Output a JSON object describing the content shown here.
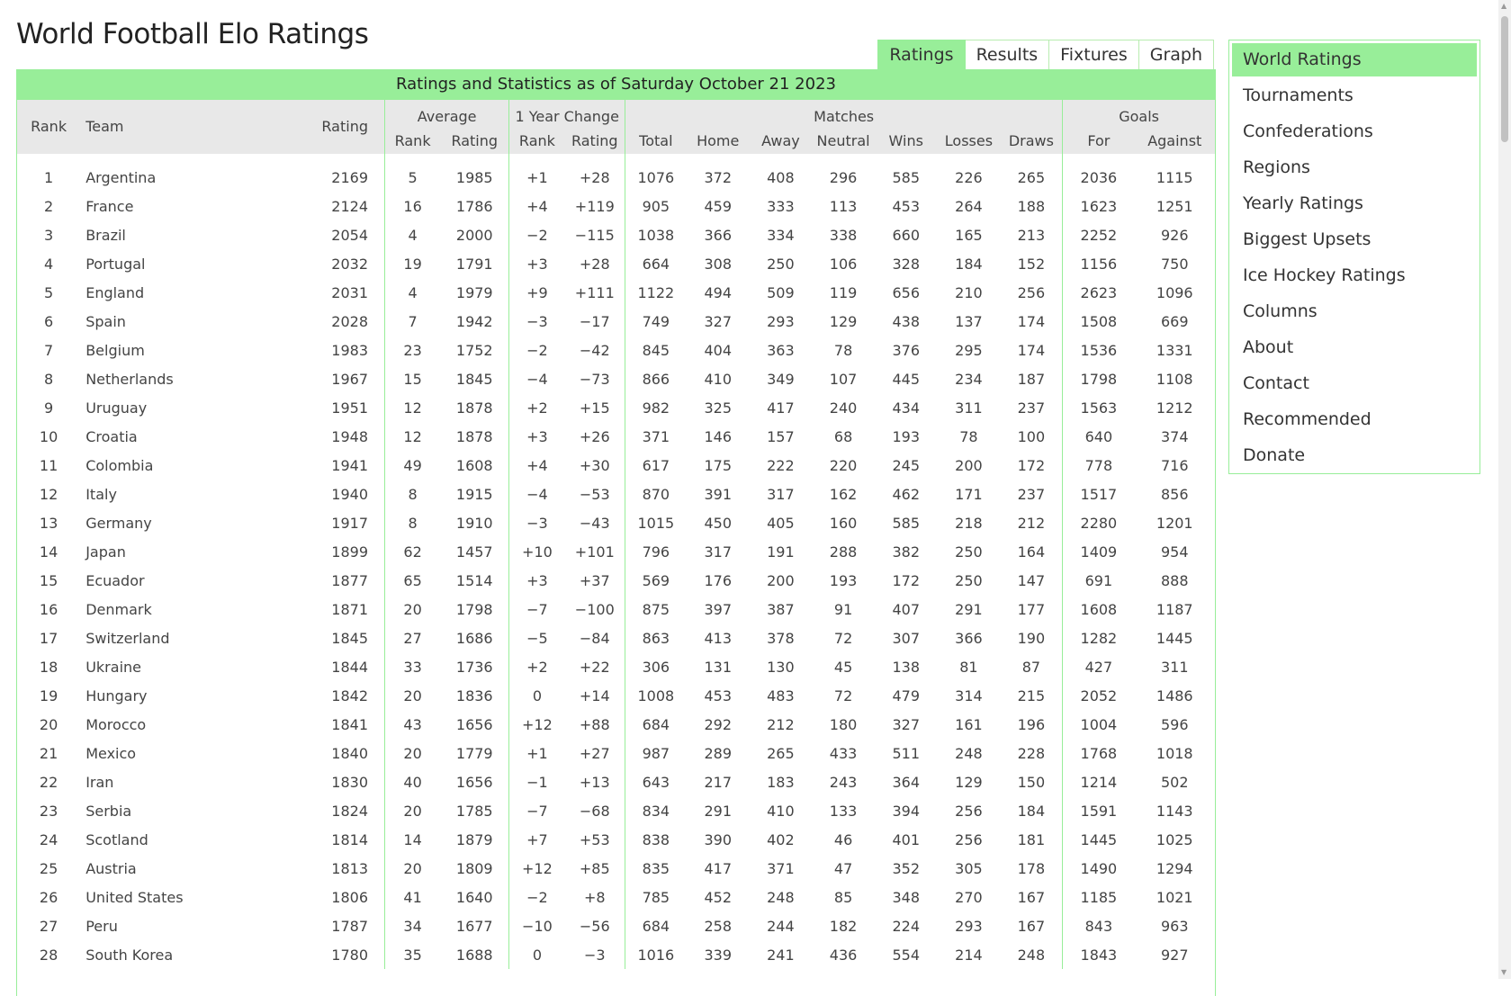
{
  "page": {
    "title": "World Football Elo Ratings"
  },
  "tabs": [
    {
      "label": "Ratings",
      "active": true
    },
    {
      "label": "Results"
    },
    {
      "label": "Fixtures"
    },
    {
      "label": "Graph"
    }
  ],
  "banner": "Ratings and Statistics as of Saturday October 21 2023",
  "headers": {
    "rank": "Rank",
    "team": "Team",
    "rating": "Rating",
    "average": "Average",
    "avg_rank": "Rank",
    "avg_rating": "Rating",
    "change": "1 Year Change",
    "chg_rank": "Rank",
    "chg_rating": "Rating",
    "matches": "Matches",
    "total": "Total",
    "home": "Home",
    "away": "Away",
    "neutral": "Neutral",
    "wins": "Wins",
    "losses": "Losses",
    "draws": "Draws",
    "goals": "Goals",
    "for": "For",
    "against": "Against"
  },
  "rows": [
    [
      "1",
      "Argentina",
      "2169",
      "5",
      "1985",
      "+1",
      "+28",
      "1076",
      "372",
      "408",
      "296",
      "585",
      "226",
      "265",
      "2036",
      "1115"
    ],
    [
      "2",
      "France",
      "2124",
      "16",
      "1786",
      "+4",
      "+119",
      "905",
      "459",
      "333",
      "113",
      "453",
      "264",
      "188",
      "1623",
      "1251"
    ],
    [
      "3",
      "Brazil",
      "2054",
      "4",
      "2000",
      "−2",
      "−115",
      "1038",
      "366",
      "334",
      "338",
      "660",
      "165",
      "213",
      "2252",
      "926"
    ],
    [
      "4",
      "Portugal",
      "2032",
      "19",
      "1791",
      "+3",
      "+28",
      "664",
      "308",
      "250",
      "106",
      "328",
      "184",
      "152",
      "1156",
      "750"
    ],
    [
      "5",
      "England",
      "2031",
      "4",
      "1979",
      "+9",
      "+111",
      "1122",
      "494",
      "509",
      "119",
      "656",
      "210",
      "256",
      "2623",
      "1096"
    ],
    [
      "6",
      "Spain",
      "2028",
      "7",
      "1942",
      "−3",
      "−17",
      "749",
      "327",
      "293",
      "129",
      "438",
      "137",
      "174",
      "1508",
      "669"
    ],
    [
      "7",
      "Belgium",
      "1983",
      "23",
      "1752",
      "−2",
      "−42",
      "845",
      "404",
      "363",
      "78",
      "376",
      "295",
      "174",
      "1536",
      "1331"
    ],
    [
      "8",
      "Netherlands",
      "1967",
      "15",
      "1845",
      "−4",
      "−73",
      "866",
      "410",
      "349",
      "107",
      "445",
      "234",
      "187",
      "1798",
      "1108"
    ],
    [
      "9",
      "Uruguay",
      "1951",
      "12",
      "1878",
      "+2",
      "+15",
      "982",
      "325",
      "417",
      "240",
      "434",
      "311",
      "237",
      "1563",
      "1212"
    ],
    [
      "10",
      "Croatia",
      "1948",
      "12",
      "1878",
      "+3",
      "+26",
      "371",
      "146",
      "157",
      "68",
      "193",
      "78",
      "100",
      "640",
      "374"
    ],
    [
      "11",
      "Colombia",
      "1941",
      "49",
      "1608",
      "+4",
      "+30",
      "617",
      "175",
      "222",
      "220",
      "245",
      "200",
      "172",
      "778",
      "716"
    ],
    [
      "12",
      "Italy",
      "1940",
      "8",
      "1915",
      "−4",
      "−53",
      "870",
      "391",
      "317",
      "162",
      "462",
      "171",
      "237",
      "1517",
      "856"
    ],
    [
      "13",
      "Germany",
      "1917",
      "8",
      "1910",
      "−3",
      "−43",
      "1015",
      "450",
      "405",
      "160",
      "585",
      "218",
      "212",
      "2280",
      "1201"
    ],
    [
      "14",
      "Japan",
      "1899",
      "62",
      "1457",
      "+10",
      "+101",
      "796",
      "317",
      "191",
      "288",
      "382",
      "250",
      "164",
      "1409",
      "954"
    ],
    [
      "15",
      "Ecuador",
      "1877",
      "65",
      "1514",
      "+3",
      "+37",
      "569",
      "176",
      "200",
      "193",
      "172",
      "250",
      "147",
      "691",
      "888"
    ],
    [
      "16",
      "Denmark",
      "1871",
      "20",
      "1798",
      "−7",
      "−100",
      "875",
      "397",
      "387",
      "91",
      "407",
      "291",
      "177",
      "1608",
      "1187"
    ],
    [
      "17",
      "Switzerland",
      "1845",
      "27",
      "1686",
      "−5",
      "−84",
      "863",
      "413",
      "378",
      "72",
      "307",
      "366",
      "190",
      "1282",
      "1445"
    ],
    [
      "18",
      "Ukraine",
      "1844",
      "33",
      "1736",
      "+2",
      "+22",
      "306",
      "131",
      "130",
      "45",
      "138",
      "81",
      "87",
      "427",
      "311"
    ],
    [
      "19",
      "Hungary",
      "1842",
      "20",
      "1836",
      "0",
      "+14",
      "1008",
      "453",
      "483",
      "72",
      "479",
      "314",
      "215",
      "2052",
      "1486"
    ],
    [
      "20",
      "Morocco",
      "1841",
      "43",
      "1656",
      "+12",
      "+88",
      "684",
      "292",
      "212",
      "180",
      "327",
      "161",
      "196",
      "1004",
      "596"
    ],
    [
      "21",
      "Mexico",
      "1840",
      "20",
      "1779",
      "+1",
      "+27",
      "987",
      "289",
      "265",
      "433",
      "511",
      "248",
      "228",
      "1768",
      "1018"
    ],
    [
      "22",
      "Iran",
      "1830",
      "40",
      "1656",
      "−1",
      "+13",
      "643",
      "217",
      "183",
      "243",
      "364",
      "129",
      "150",
      "1214",
      "502"
    ],
    [
      "23",
      "Serbia",
      "1824",
      "20",
      "1785",
      "−7",
      "−68",
      "834",
      "291",
      "410",
      "133",
      "394",
      "256",
      "184",
      "1591",
      "1143"
    ],
    [
      "24",
      "Scotland",
      "1814",
      "14",
      "1879",
      "+7",
      "+53",
      "838",
      "390",
      "402",
      "46",
      "401",
      "256",
      "181",
      "1445",
      "1025"
    ],
    [
      "25",
      "Austria",
      "1813",
      "20",
      "1809",
      "+12",
      "+85",
      "835",
      "417",
      "371",
      "47",
      "352",
      "305",
      "178",
      "1490",
      "1294"
    ],
    [
      "26",
      "United States",
      "1806",
      "41",
      "1640",
      "−2",
      "+8",
      "785",
      "452",
      "248",
      "85",
      "348",
      "270",
      "167",
      "1185",
      "1021"
    ],
    [
      "27",
      "Peru",
      "1787",
      "34",
      "1677",
      "−10",
      "−56",
      "684",
      "258",
      "244",
      "182",
      "224",
      "293",
      "167",
      "843",
      "963"
    ],
    [
      "28",
      "South Korea",
      "1780",
      "35",
      "1688",
      "0",
      "−3",
      "1016",
      "339",
      "241",
      "436",
      "554",
      "214",
      "248",
      "1843",
      "927"
    ]
  ],
  "sidebar": [
    {
      "label": "World Ratings",
      "active": true
    },
    {
      "label": "Tournaments"
    },
    {
      "label": "Confederations"
    },
    {
      "label": "Regions"
    },
    {
      "label": "Yearly Ratings"
    },
    {
      "label": "Biggest Upsets"
    },
    {
      "label": "Ice Hockey Ratings"
    },
    {
      "label": "Columns"
    },
    {
      "label": "About"
    },
    {
      "label": "Contact"
    },
    {
      "label": "Recommended"
    },
    {
      "label": "Donate"
    }
  ],
  "colors": {
    "accent": "#98ee99",
    "header_bg": "#e8e8e8"
  }
}
